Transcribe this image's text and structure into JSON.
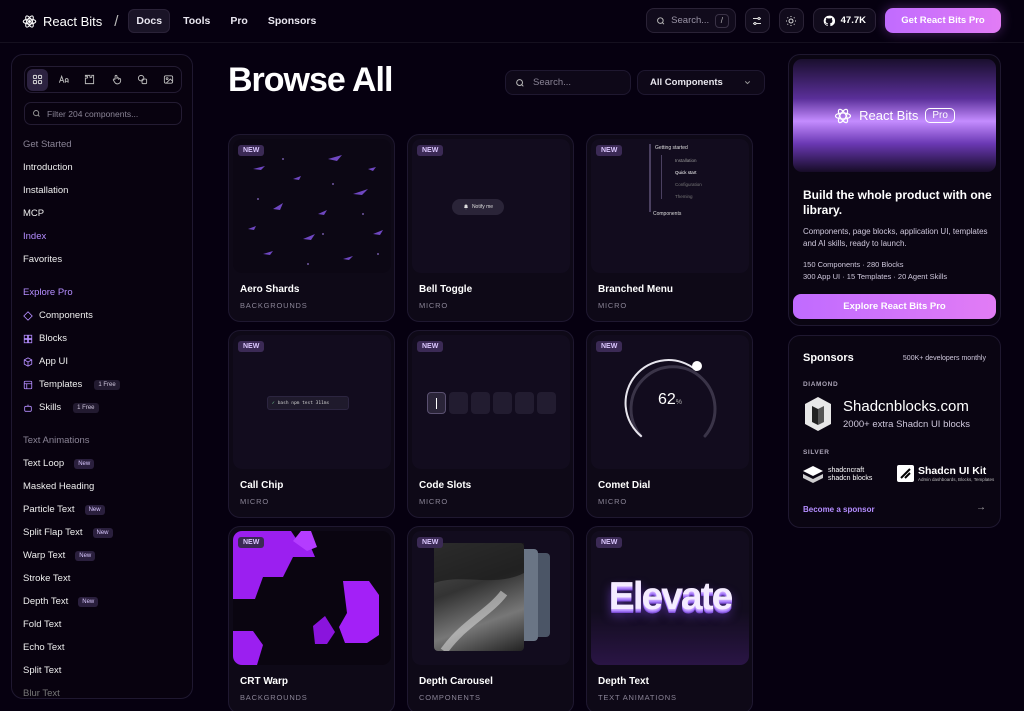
{
  "nav": {
    "brand": "React Bits",
    "separator": "/",
    "links": [
      "Docs",
      "Tools",
      "Pro",
      "Sponsors"
    ],
    "search_label": "Search...",
    "search_kbd": "/",
    "stars": "47.7K",
    "cta": "Get React Bits Pro"
  },
  "sidebar": {
    "filter_placeholder": "Filter 204 components...",
    "get_started": {
      "heading": "Get Started",
      "items": [
        "Introduction",
        "Installation",
        "MCP",
        "Index",
        "Favorites"
      ]
    },
    "explore_pro": {
      "heading": "Explore Pro",
      "items": [
        {
          "label": "Components",
          "badge": ""
        },
        {
          "label": "Blocks",
          "badge": ""
        },
        {
          "label": "App UI",
          "badge": ""
        },
        {
          "label": "Templates",
          "badge": "1 Free"
        },
        {
          "label": "Skills",
          "badge": "1 Free"
        }
      ]
    },
    "text_animations": {
      "heading": "Text Animations",
      "items": [
        {
          "label": "Text Loop",
          "badge": "New"
        },
        {
          "label": "Masked Heading",
          "badge": ""
        },
        {
          "label": "Particle Text",
          "badge": "New"
        },
        {
          "label": "Split Flap Text",
          "badge": "New"
        },
        {
          "label": "Warp Text",
          "badge": "New"
        },
        {
          "label": "Stroke Text",
          "badge": ""
        },
        {
          "label": "Depth Text",
          "badge": "New"
        },
        {
          "label": "Fold Text",
          "badge": ""
        },
        {
          "label": "Echo Text",
          "badge": ""
        },
        {
          "label": "Split Text",
          "badge": ""
        },
        {
          "label": "Blur Text",
          "badge": ""
        }
      ]
    }
  },
  "main": {
    "title": "Browse All",
    "search_placeholder": "Search...",
    "filter_value": "All Components",
    "new_tag": "NEW",
    "cards": [
      {
        "name": "Aero Shards",
        "category": "BACKGROUNDS"
      },
      {
        "name": "Bell Toggle",
        "category": "MICRO"
      },
      {
        "name": "Branched Menu",
        "category": "MICRO"
      },
      {
        "name": "Call Chip",
        "category": "MICRO"
      },
      {
        "name": "Code Slots",
        "category": "MICRO"
      },
      {
        "name": "Comet Dial",
        "category": "MICRO"
      },
      {
        "name": "CRT Warp",
        "category": "BACKGROUNDS"
      },
      {
        "name": "Depth Carousel",
        "category": "COMPONENTS"
      },
      {
        "name": "Depth Text",
        "category": "TEXT ANIMATIONS"
      }
    ],
    "preview_texts": {
      "bell_chip": "Notify me",
      "branch_title": "Getting started",
      "branch_items": [
        "Installation",
        "Quick start",
        "Configuration",
        "Theming"
      ],
      "branch_footer": "Components",
      "call_chip": "bash npm test 311ms",
      "dial_value": "62",
      "dial_unit": "%",
      "depth_text": "Elevate"
    }
  },
  "promo": {
    "image_brand": "React Bits",
    "image_pill": "Pro",
    "heading": "Build the whole product with one library.",
    "description": "Components, page blocks, application UI, templates and AI skills, ready to launch.",
    "stats_line1": "150 Components · 280 Blocks",
    "stats_line2": "300 App UI · 15 Templates · 20 Agent Skills",
    "button": "Explore React Bits Pro"
  },
  "sponsors": {
    "title": "Sponsors",
    "audience": "500K+ developers monthly",
    "diamond_label": "DIAMOND",
    "diamond_name": "Shadcnblocks.com",
    "diamond_sub": "2000+ extra Shadcn UI blocks",
    "silver_label": "SILVER",
    "silver1_line1": "shadcncraft",
    "silver1_line2": "shadcn blocks",
    "silver2_name": "Shadcn UI Kit",
    "silver2_sub": "Admin dashboards, Blocks, Templates",
    "become": "Become a sponsor",
    "arrow": "→"
  }
}
